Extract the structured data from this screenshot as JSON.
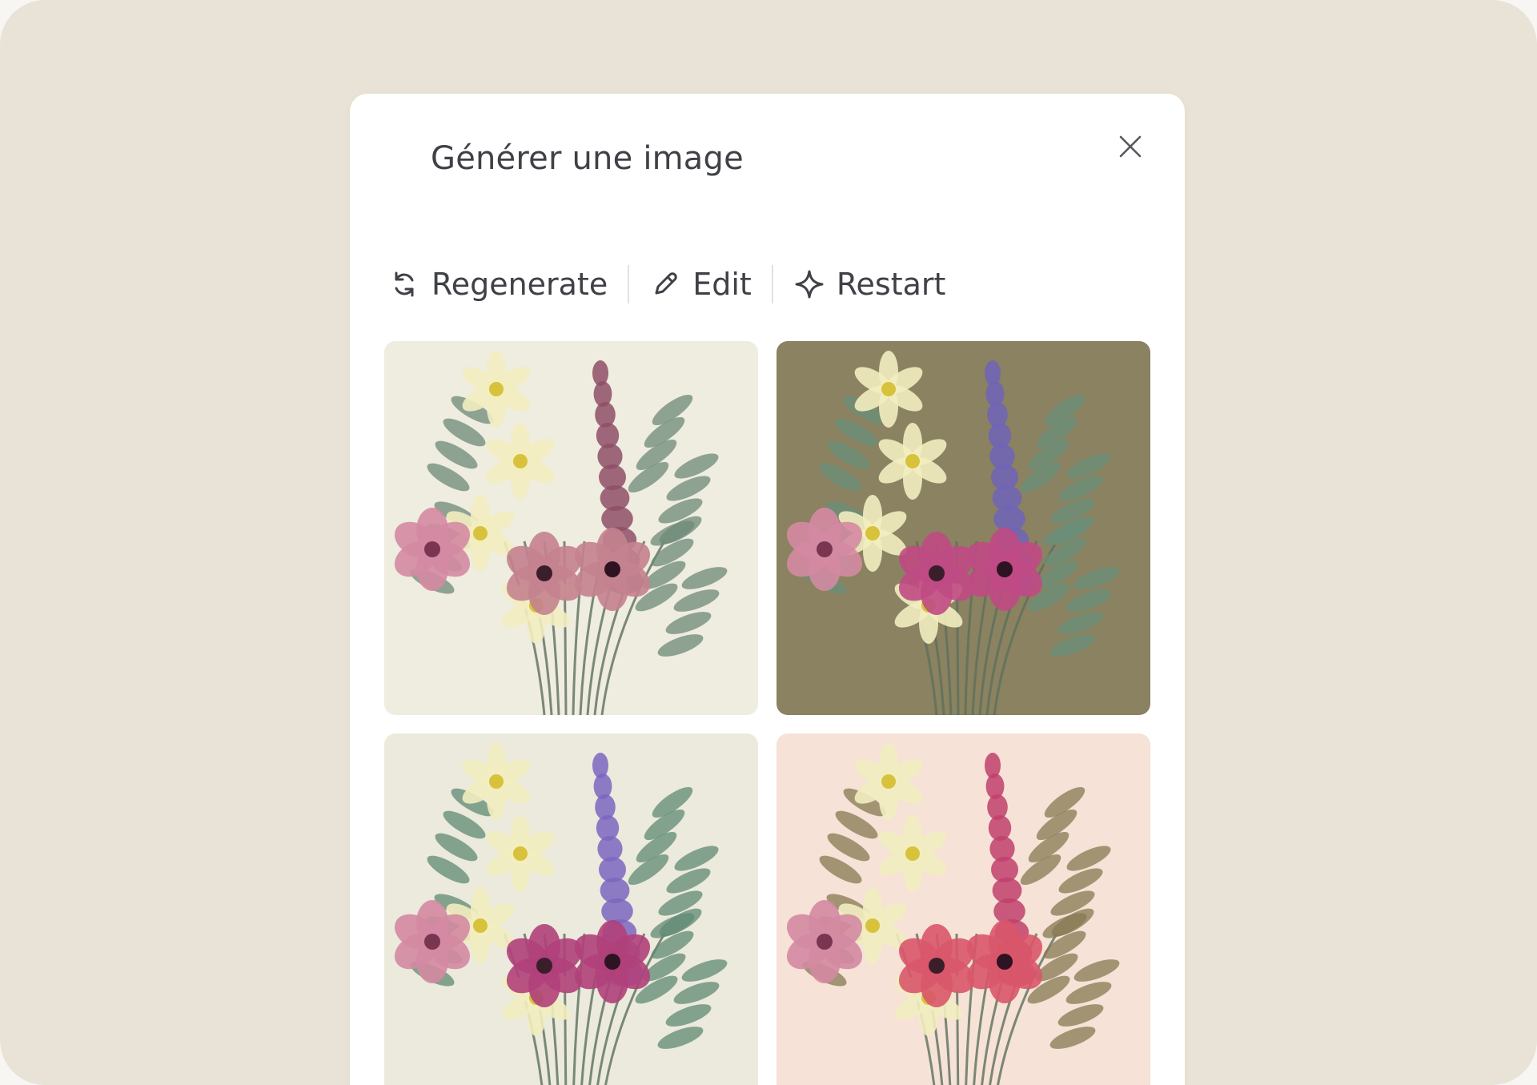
{
  "dialog": {
    "title": "Générer une image",
    "close_icon": "close-icon"
  },
  "toolbar": {
    "regenerate": {
      "label": "Regenerate",
      "icon": "refresh-icon"
    },
    "edit": {
      "label": "Edit",
      "icon": "pencil-icon"
    },
    "restart": {
      "label": "Restart",
      "icon": "sparkle-icon"
    }
  },
  "images": [
    {
      "name": "generated-image-1",
      "background": "#efece0",
      "spike": "#8e4f66",
      "accent": "#c4828f",
      "leaf": "#6d8a78"
    },
    {
      "name": "generated-image-2",
      "background": "#8a8260",
      "spike": "#6f64b8",
      "accent": "#c04a84",
      "leaf": "#6a8f7a"
    },
    {
      "name": "generated-image-3",
      "background": "#ebeadc",
      "spike": "#7c66bf",
      "accent": "#b0407a",
      "leaf": "#5f8a74"
    },
    {
      "name": "generated-image-4",
      "background": "#f6e2d6",
      "spike": "#c0406c",
      "accent": "#d9566a",
      "leaf": "#857a52"
    }
  ],
  "colors": {
    "page_background": "#e8e3d6",
    "dialog_background": "#ffffff",
    "text": "#3f4147"
  }
}
